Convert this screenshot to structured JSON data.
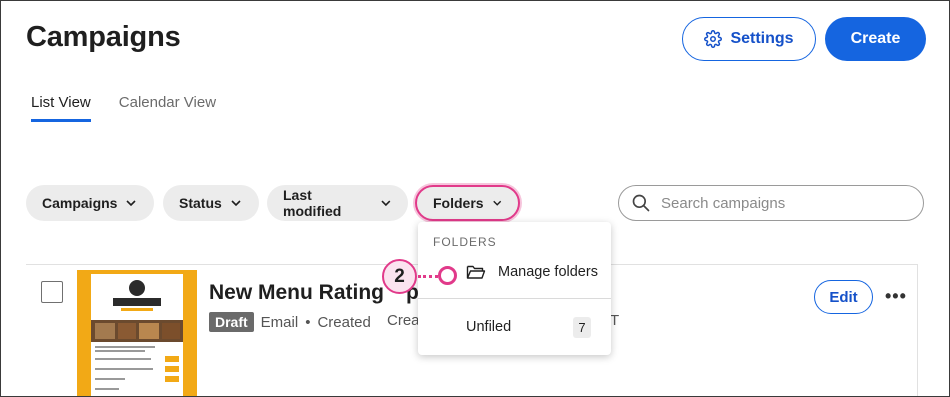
{
  "header": {
    "title": "Campaigns",
    "settings_label": "Settings",
    "create_label": "Create"
  },
  "tabs": [
    {
      "label": "List View",
      "active": true
    },
    {
      "label": "Calendar View",
      "active": false
    }
  ],
  "filters": {
    "campaigns": "Campaigns",
    "status": "Status",
    "last_modified": "Last modified",
    "folders": "Folders"
  },
  "search": {
    "placeholder": "Search campaigns",
    "value": ""
  },
  "campaign": {
    "name": "New Menu Rating",
    "name_suffix": "p",
    "status_badge": "Draft",
    "type": "Email",
    "separator": "•",
    "state": "Created",
    "created_partial": "Crea",
    "trailing_partial": "T",
    "edit_label": "Edit",
    "more_label": "•••"
  },
  "folders_dropdown": {
    "header": "FOLDERS",
    "manage_label": "Manage folders",
    "unfiled_label": "Unfiled",
    "unfiled_count": "7"
  },
  "callout": {
    "number": "2"
  },
  "colors": {
    "primary": "#1565e0",
    "callout_pink": "#e13a8a",
    "thumbnail_orange": "#f2a916",
    "draft_badge": "#6a6a6a"
  }
}
